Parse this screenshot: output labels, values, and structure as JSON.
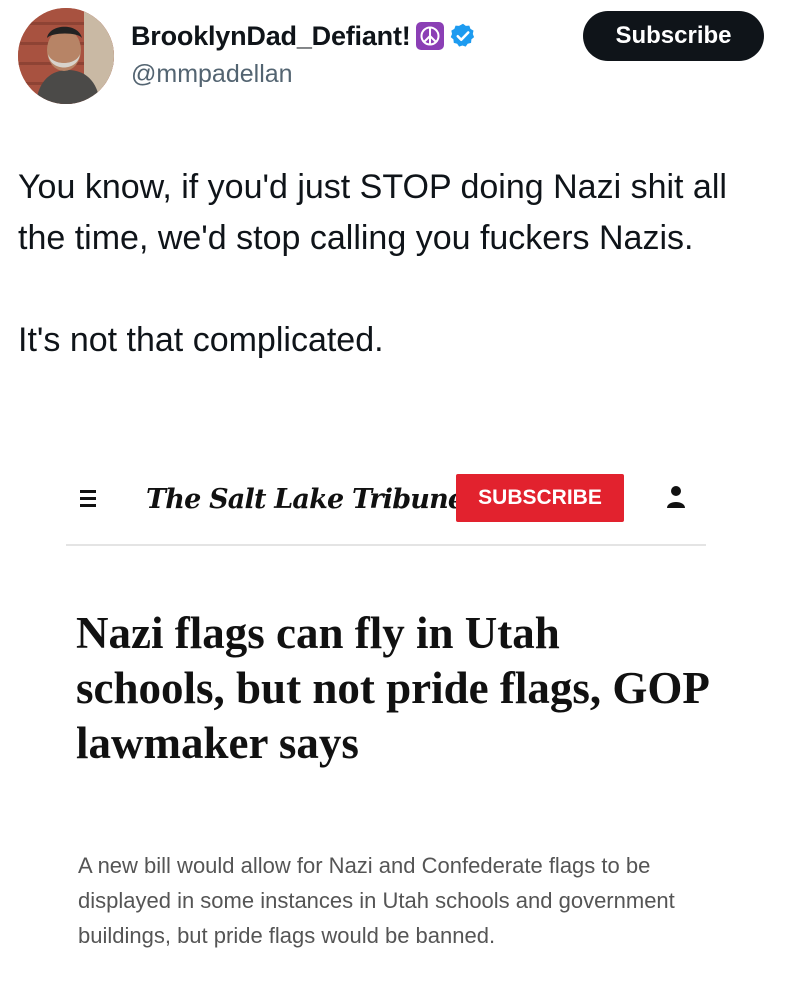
{
  "post": {
    "display_name": "BrooklynDad_Defiant!",
    "handle": "@mmpadellan",
    "subscribe_label": "Subscribe",
    "badges": [
      "peace-sign-emoji",
      "verified-badge"
    ],
    "verified_color": "#1d9bf0",
    "text_paragraphs": [
      "You know, if you'd just STOP doing Nazi shit all the time, we'd stop calling you fuckers Nazis.",
      "It's not that complicated."
    ]
  },
  "embedded_article": {
    "publication": "The Salt Lake Tribune",
    "subscribe_label": "SUBSCRIBE",
    "subscribe_color": "#e2222e",
    "headline": "Nazi flags can fly in Utah schools, but not pride flags, GOP lawmaker says",
    "dek": "A new bill would allow for Nazi and Confederate flags to be displayed in some instances in Utah schools and government buildings, but pride flags would be banned.",
    "icons": [
      "hamburger-menu-icon",
      "account-icon"
    ]
  }
}
